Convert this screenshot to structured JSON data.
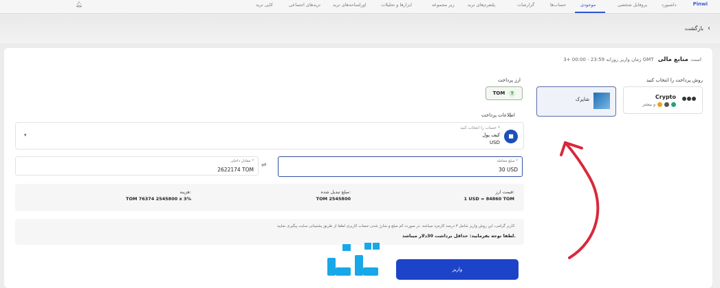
{
  "nav": {
    "logo": "Pinwi",
    "items": [
      {
        "label": "داشبورد",
        "active": false
      },
      {
        "label": "پروفایل شخصی",
        "active": false
      },
      {
        "label": "موجودی",
        "active": true
      },
      {
        "label": "حساب‌ها",
        "active": false
      },
      {
        "label": "گزارشات",
        "active": false
      },
      {
        "label": "پلتفرم‌های ترید",
        "active": false
      },
      {
        "label": "زیر مجموعه",
        "active": false
      },
      {
        "label": "ابزارها و تحلیلات",
        "active": false
      },
      {
        "label": "اورلساحه‌های ترید",
        "active": false
      },
      {
        "label": "ترید‌های اجتماعی",
        "active": false
      },
      {
        "label": "کاپی ترید",
        "active": false
      }
    ]
  },
  "back": {
    "label": "بازگشت"
  },
  "header": {
    "title": "منابع مالی",
    "subtitle": "زمان واریز روزانه 23:59 - 00:00 +3 GMT است."
  },
  "method": {
    "label": "روش پرداخت را انتخاب کنید",
    "crypto": {
      "title": "Crypto",
      "sub": "و بیشتر"
    },
    "shaparak": {
      "name": "شاپرک"
    }
  },
  "currency": {
    "label": "ارز پرداخت",
    "value": "TOM",
    "icon": "t-currency-icon"
  },
  "payment_info": {
    "label": "اطلاعات پرداخت"
  },
  "wallet": {
    "placeholder": "حساب را انتخاب کنید *",
    "name": "کیف پول",
    "currency": "USD"
  },
  "amount": {
    "source_caption": "مبلغ معامله *",
    "source_value": "30 USD",
    "dest_caption": "معادل داخلی *",
    "dest_value": "2622174 TOM"
  },
  "summary": {
    "rate_label": "قیمت ارز:",
    "rate_value": "1 USD = 84860 TOM",
    "converted_label": "مبلغ تبدیل شده:",
    "converted_value": "TOM 2545800",
    "fee_label": "هزینه:",
    "fee_value": "TOM 76374  2545800 x 3%"
  },
  "notice": {
    "line1": "کاربر گرامی، این روش واریز شامل ۳ درصد کارمزد میباشد. در صورت کم مبلغ و شارژ شدن حساب کاربری لطفا از طریق پشتیبانی سایت پیگیری نمایید.",
    "line2": "لطفا توجه بفرمایید: حداقل برداشت 30دلار میباشد."
  },
  "submit": {
    "label": "واریز"
  },
  "colors": {
    "accent": "#1d43c9",
    "annotation": "#d9283a",
    "watermark": "#18a8e8"
  }
}
